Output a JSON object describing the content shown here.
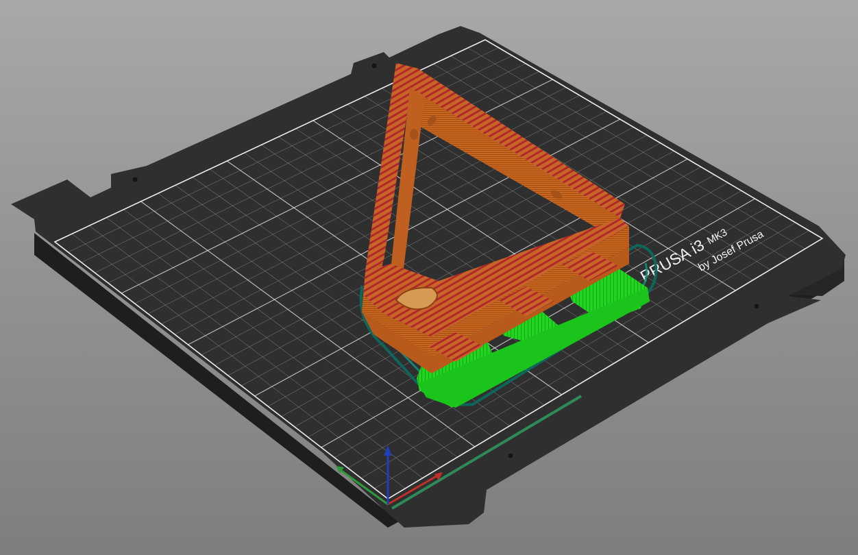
{
  "app": {
    "view": "3D print preview"
  },
  "bed": {
    "brand_line": "PRUSA i3",
    "model_suffix": "MK3",
    "maker_line": "by Josef Prusa"
  },
  "axes": {
    "x": {
      "color": "#c0302a"
    },
    "y": {
      "color": "#2f9a3c"
    },
    "z": {
      "color": "#1f3fb5"
    }
  },
  "features": {
    "perimeter_color": "#c8661f",
    "infill_color": "#b22a2a",
    "support_color": "#19d419",
    "skirt_color": "#0b6b5e",
    "top_solid_color": "#e0a040"
  },
  "colors": {
    "background": "#959595",
    "bed": "#303030",
    "grid": "#e8e8e8"
  }
}
